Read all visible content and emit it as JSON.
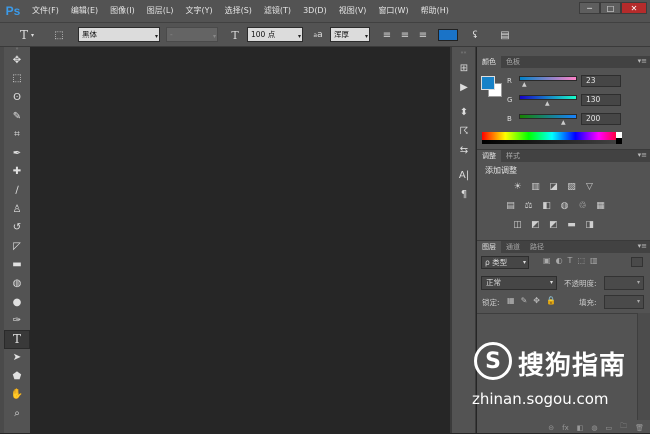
{
  "app": {
    "logo": "Ps"
  },
  "menu": [
    "文件(F)",
    "编辑(E)",
    "图像(I)",
    "图层(L)",
    "文字(Y)",
    "选择(S)",
    "滤镜(T)",
    "3D(D)",
    "视图(V)",
    "窗口(W)",
    "帮助(H)"
  ],
  "window_buttons": {
    "minimize": "─",
    "restore": "□",
    "close": "✕"
  },
  "options": {
    "tool_glyph": "T",
    "font_family": "黑体",
    "font_style": "-",
    "size_glyph": "T",
    "font_size": "100 点",
    "aa_glyph": "a",
    "antialias": "浑厚",
    "text_color": "#1a73c7"
  },
  "tools": [
    "move",
    "marquee",
    "lasso",
    "quick-select",
    "crop",
    "eyedropper",
    "spot-heal",
    "brush",
    "clone-stamp",
    "history-brush",
    "eraser",
    "gradient",
    "blur",
    "dodge",
    "pen",
    "type",
    "path-select",
    "shape",
    "hand",
    "zoom"
  ],
  "tool_glyphs": [
    "✥",
    "⬚",
    "ʘ",
    "✎",
    "⌗",
    "✒",
    "✚",
    "∕",
    "♙",
    "↺",
    "◸",
    "▬",
    "◍",
    "●",
    "✑",
    "T",
    "➤",
    "⬟",
    "✋",
    "⌕"
  ],
  "dock_glyphs": [
    "⊞",
    "▶",
    "⬍",
    "☈",
    "⇆",
    "A|",
    "¶"
  ],
  "color_panel": {
    "tabs": [
      "颜色",
      "色板"
    ],
    "channels": [
      {
        "label": "R",
        "value": "23"
      },
      {
        "label": "G",
        "value": "130"
      },
      {
        "label": "B",
        "value": "200"
      }
    ],
    "foreground": "#1782c8"
  },
  "adjust_panel": {
    "tabs": [
      "调整",
      "样式"
    ],
    "title": "添加调整",
    "row1": [
      "☀",
      "▥",
      "◪",
      "▨",
      "▽"
    ],
    "row2": [
      "▤",
      "⚖",
      "◧",
      "◍",
      "♲",
      "▦"
    ],
    "row3": [
      "◫",
      "◩",
      "◩",
      "▬",
      "◨"
    ]
  },
  "layers_panel": {
    "tabs": [
      "图层",
      "通道",
      "路径"
    ],
    "filter": "ρ 类型",
    "blend": "正常",
    "opacity_label": "不透明度:",
    "lock_label": "锁定:",
    "fill_label": "填充:",
    "footer": [
      "⊝",
      "fx",
      "◧",
      "◍",
      "▭",
      "🗀",
      "🗑"
    ]
  },
  "watermark": {
    "brand": "搜狗指南",
    "url": "zhinan.sogou.com",
    "logo_glyph": "S"
  }
}
